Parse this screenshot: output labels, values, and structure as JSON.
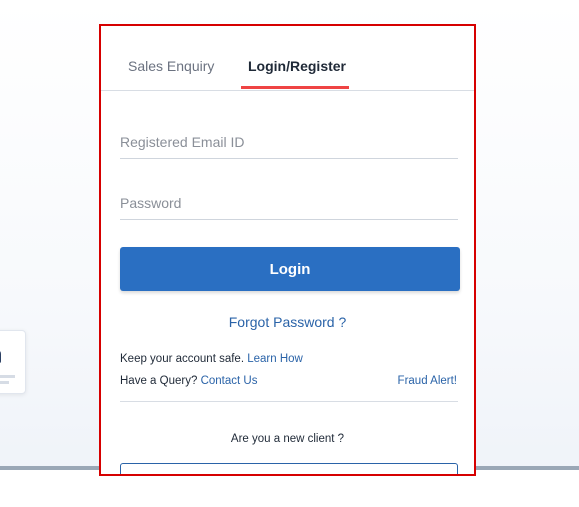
{
  "tabs": {
    "sales_enquiry": "Sales Enquiry",
    "login_register": "Login/Register"
  },
  "form": {
    "email_placeholder": "Registered Email ID",
    "email_value": "",
    "password_placeholder": "Password",
    "password_value": "",
    "login_label": "Login",
    "forgot_label": "Forgot Password ?"
  },
  "info": {
    "keep_safe_text": "Keep your account safe.",
    "learn_how": "Learn How",
    "query_text": "Have a Query?",
    "contact_us": "Contact Us",
    "fraud_alert": "Fraud Alert!",
    "new_client_text": "Are you a new client ?"
  },
  "colors": {
    "accent": "#2a6fc2",
    "link": "#2a63a8",
    "active_tab_underline": "#ef4444",
    "panel_border": "#d60000"
  },
  "icons": {
    "side_widget": "bell-icon"
  }
}
